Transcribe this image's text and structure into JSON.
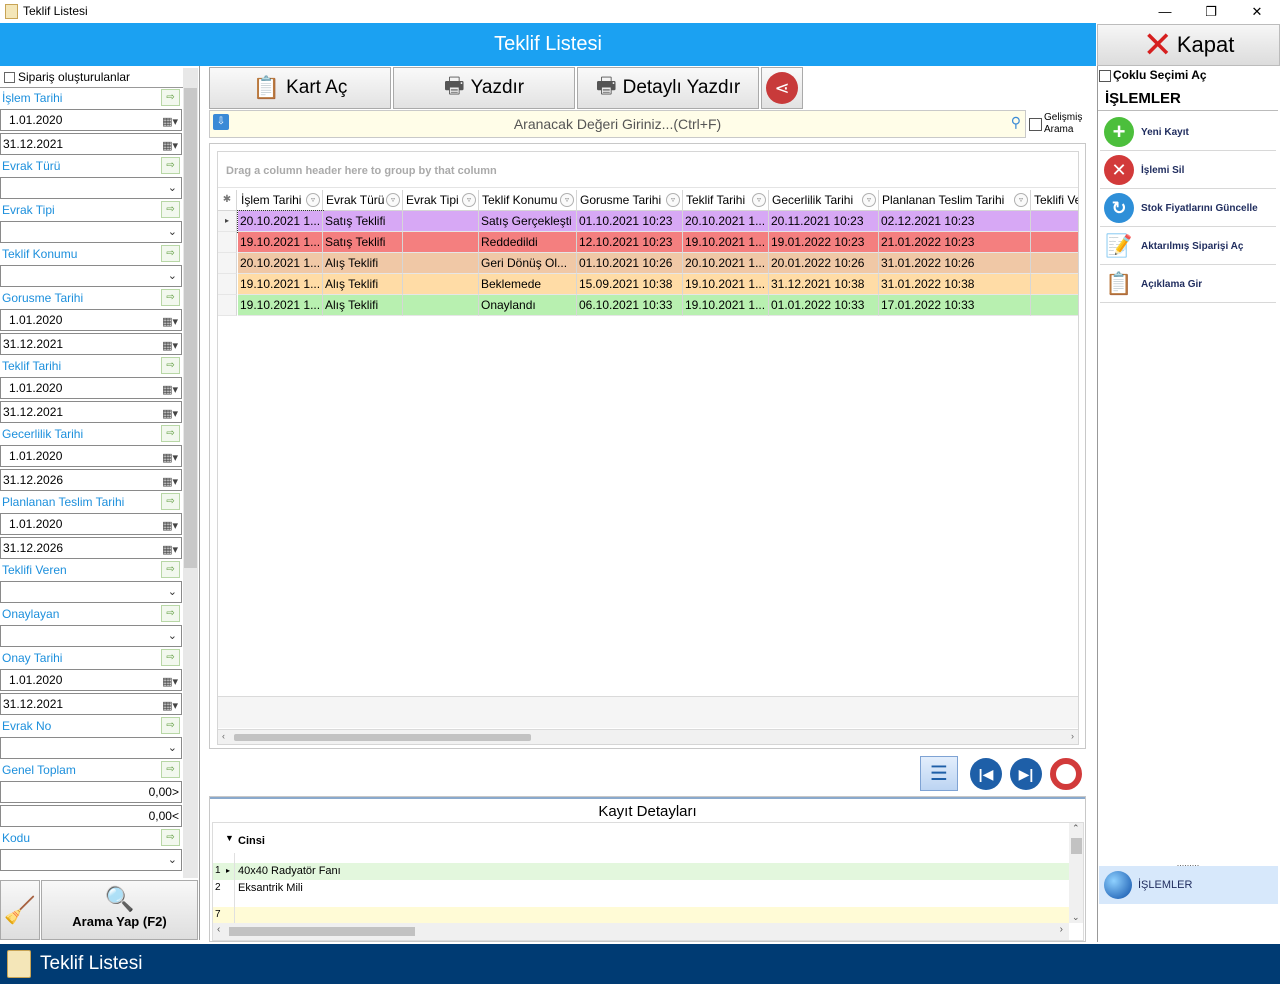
{
  "window": {
    "title": "Teklif Listesi",
    "controls": [
      "—",
      "❐",
      "✕"
    ]
  },
  "header": {
    "title": "Teklif Listesi",
    "close_label": "Kapat"
  },
  "filters": {
    "siparis_checkbox": "Sipariş oluşturulanlar",
    "islem_tarihi": {
      "label": "İşlem Tarihi",
      "from": "1.01.2020",
      "to": "31.12.2021"
    },
    "evrak_turu": {
      "label": "Evrak Türü",
      "value": ""
    },
    "evrak_tipi": {
      "label": "Evrak Tipi",
      "value": ""
    },
    "teklif_konumu": {
      "label": "Teklif Konumu",
      "value": ""
    },
    "gorusme_tarihi": {
      "label": "Gorusme Tarihi",
      "from": "1.01.2020",
      "to": "31.12.2021"
    },
    "teklif_tarihi": {
      "label": "Teklif Tarihi",
      "from": "1.01.2020",
      "to": "31.12.2021"
    },
    "gecerlilik_tarihi": {
      "label": "Gecerlilik Tarihi",
      "from": "1.01.2020",
      "to": "31.12.2026"
    },
    "planlanan_teslim_tarihi": {
      "label": "Planlanan Teslim Tarihi",
      "from": "1.01.2020",
      "to": "31.12.2026"
    },
    "teklifi_veren": {
      "label": "Teklifi Veren",
      "value": ""
    },
    "onaylayan": {
      "label": "Onaylayan",
      "value": ""
    },
    "onay_tarihi": {
      "label": "Onay Tarihi",
      "from": "1.01.2020",
      "to": "31.12.2021"
    },
    "evrak_no": {
      "label": "Evrak No",
      "value": ""
    },
    "genel_toplam": {
      "label": "Genel Toplam",
      "min": "0,00>",
      "max": "0,00<"
    },
    "kodu": {
      "label": "Kodu",
      "value": ""
    },
    "search_button": "Arama Yap (F2)"
  },
  "toolbar": {
    "kart_ac": "Kart Aç",
    "yazdir": "Yazdır",
    "detayli_yazdir": "Detaylı Yazdır"
  },
  "search": {
    "placeholder": "Aranacak Değeri Giriniz...(Ctrl+F)",
    "advanced": "Gelişmiş Arama"
  },
  "grid": {
    "group_panel": "Drag a column header here to group by that column",
    "columns": [
      "İşlem Tarihi",
      "Evrak Türü",
      "Evrak Tipi",
      "Teklif Konumu",
      "Gorusme Tarihi",
      "Teklif Tarihi",
      "Gecerlilik Tarihi",
      "Planlanan Teslim Tarihi",
      "Teklifi Ve"
    ],
    "rows": [
      {
        "color": "#d7a8f5",
        "cells": [
          "20.10.2021 1...",
          "Satış Teklifi",
          "",
          "Satış Gerçekleşti",
          "01.10.2021 10:23",
          "20.10.2021 1...",
          "20.11.2021 10:23",
          "02.12.2021 10:23",
          ""
        ]
      },
      {
        "color": "#f47f7f",
        "cells": [
          "19.10.2021 1...",
          "Satış Teklifi",
          "",
          "Reddedildi",
          "12.10.2021 10:23",
          "19.10.2021 1...",
          "19.01.2022 10:23",
          "21.01.2022 10:23",
          ""
        ]
      },
      {
        "color": "#f0c8a6",
        "cells": [
          "20.10.2021 1...",
          "Alış Teklifi",
          "",
          "Geri Dönüş Ol...",
          "01.10.2021 10:26",
          "20.10.2021 1...",
          "20.01.2022 10:26",
          "31.01.2022 10:26",
          ""
        ]
      },
      {
        "color": "#ffdca6",
        "cells": [
          "19.10.2021 1...",
          "Alış Teklifi",
          "",
          "Beklemede",
          "15.09.2021 10:38",
          "19.10.2021 1...",
          "31.12.2021 10:38",
          "31.01.2022 10:38",
          ""
        ]
      },
      {
        "color": "#b8f0b0",
        "cells": [
          "19.10.2021 1...",
          "Alış Teklifi",
          "",
          "Onaylandı",
          "06.10.2021 10:33",
          "19.10.2021 1...",
          "01.01.2022 10:33",
          "17.01.2022 10:33",
          ""
        ]
      }
    ]
  },
  "details": {
    "title": "Kayıt Detayları",
    "column": "Cinsi",
    "rows": [
      {
        "num": "1",
        "text": "40x40 Radyatör Fanı"
      },
      {
        "num": "2",
        "text": "Eksantrik Mili"
      },
      {
        "num": "7",
        "text": ""
      }
    ]
  },
  "right": {
    "multi_select": "Çoklu Seçimi Aç",
    "ops_title": "İŞLEMLER",
    "items": [
      "Yeni Kayıt",
      "İşlemi Sil",
      "Stok Fiyatlarını Güncelle",
      "Aktarılmış Siparişi Aç",
      "Açıklama Gir"
    ],
    "footer_label": "İŞLEMLER"
  },
  "taskbar": {
    "label": "Teklif Listesi"
  }
}
